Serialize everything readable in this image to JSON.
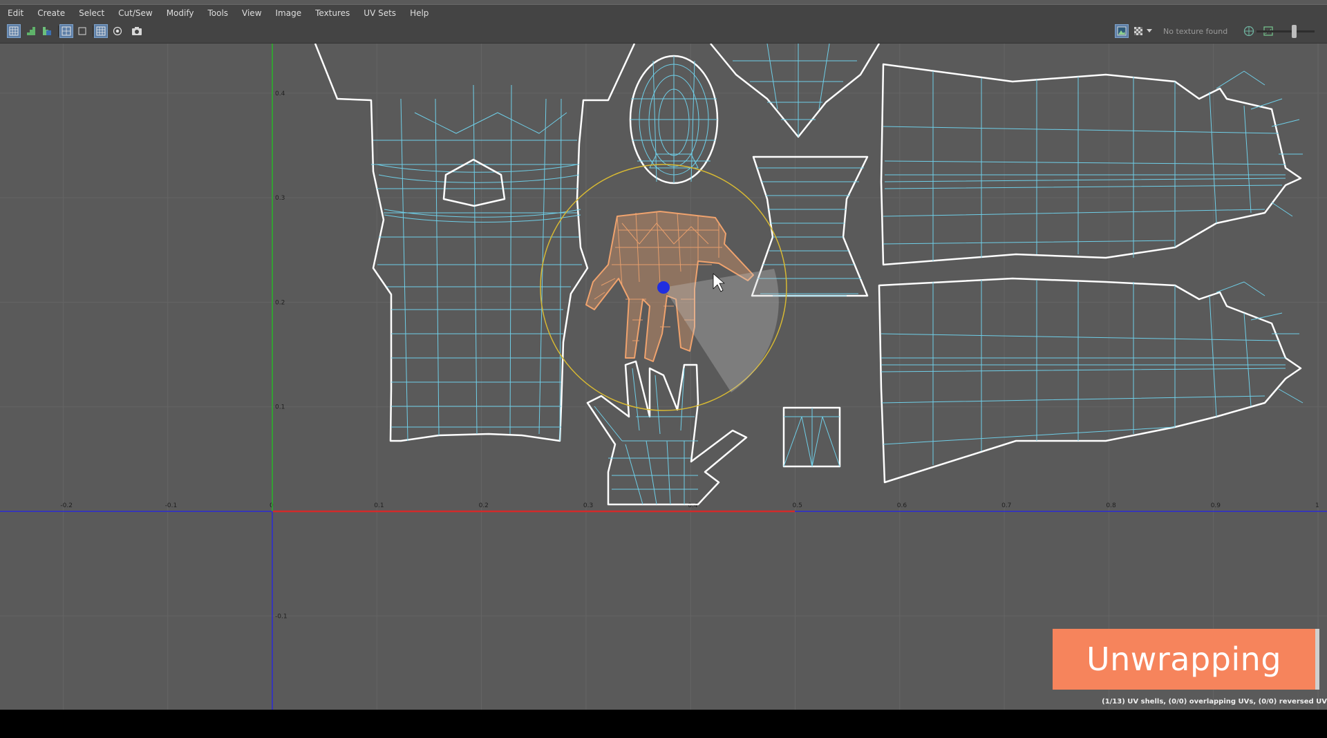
{
  "menu": [
    "Edit",
    "Create",
    "Select",
    "Cut/Sew",
    "Modify",
    "Tools",
    "View",
    "Image",
    "Textures",
    "UV Sets",
    "Help"
  ],
  "toolbar": {
    "left_icons": [
      "uv-grid-icon",
      "stair-up-icon",
      "stair-down-icon",
      "checker-view-icon",
      "grid-single-icon",
      "grid-toggle-icon",
      "texture-circle-icon",
      "snapshot-camera-icon"
    ],
    "right_icons": [
      "image-display-icon",
      "checker-pattern-icon",
      "dropdown-arrow-icon",
      "uv-globe-icon",
      "texture-frame-icon"
    ],
    "texture_status": "No texture found",
    "zoom_level": 0.62
  },
  "viewport": {
    "x_ticks": [
      "-0.2",
      "-0.1",
      "0",
      "0.1",
      "0.2",
      "0.3",
      "0.4",
      "0.5",
      "0.6",
      "0.7",
      "0.8",
      "0.9",
      "1"
    ],
    "y_ticks": [
      "0.4",
      "0.3",
      "0.2",
      "0.1",
      "-0.1"
    ],
    "colors": {
      "background": "#5a5a5a",
      "grid": "#656565",
      "shell_border": "#ffffff",
      "shell_edges": "#6fcfe8",
      "selected_shell": "#f0a36e",
      "tool_ring": "#d7b933",
      "pivot": "#1f2ee0",
      "axis_u": "#2b2bd6",
      "axis_v": "#27b627",
      "axis_red": "#d22a2a"
    }
  },
  "overlay": {
    "title": "Unwrapping",
    "color": "#f6845c"
  },
  "status_line": "(1/13) UV shells, (0/0) overlapping UVs, (0/0) reversed UV"
}
